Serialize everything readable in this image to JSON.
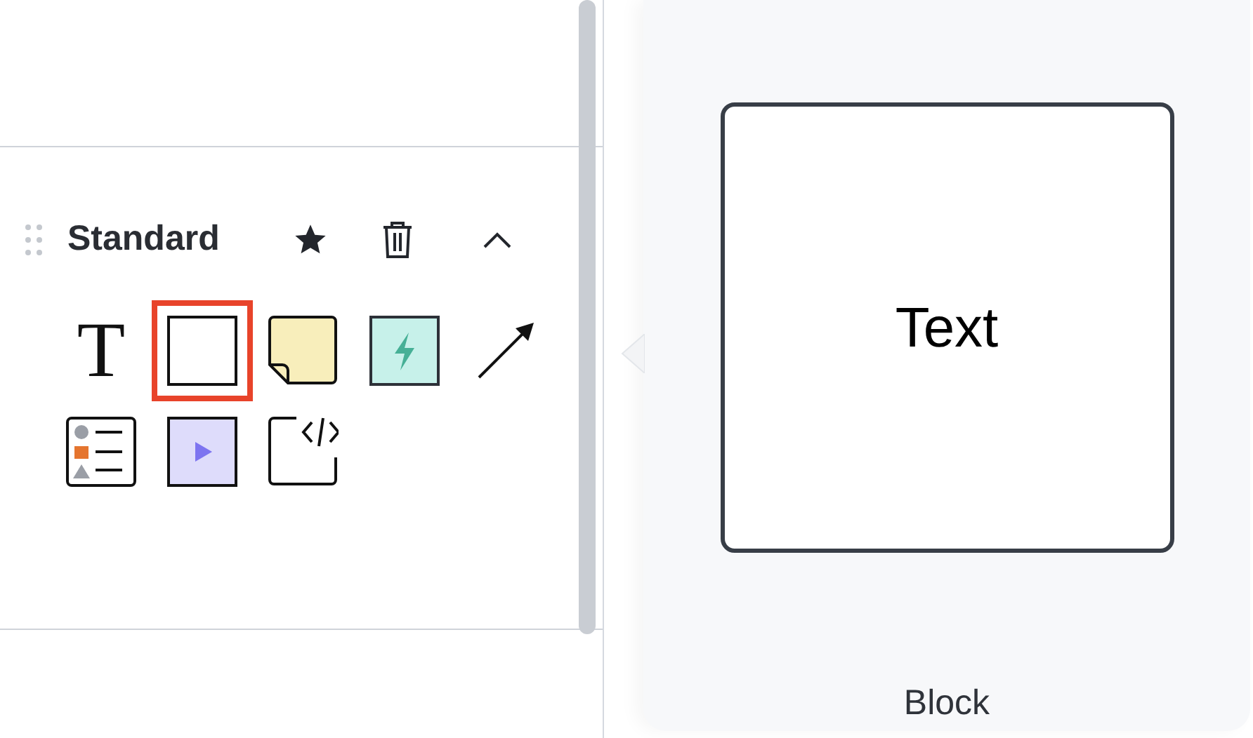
{
  "section": {
    "title": "Standard",
    "expanded": true
  },
  "tools": [
    {
      "kind": "text",
      "glyph": "T",
      "selected": false
    },
    {
      "kind": "rectangle",
      "selected": true
    },
    {
      "kind": "sticky",
      "selected": false
    },
    {
      "kind": "action",
      "selected": false
    },
    {
      "kind": "arrow",
      "selected": false
    },
    {
      "kind": "list",
      "selected": false
    },
    {
      "kind": "video",
      "selected": false
    },
    {
      "kind": "embed",
      "selected": false
    }
  ],
  "preview": {
    "text": "Text",
    "label": "Block"
  }
}
